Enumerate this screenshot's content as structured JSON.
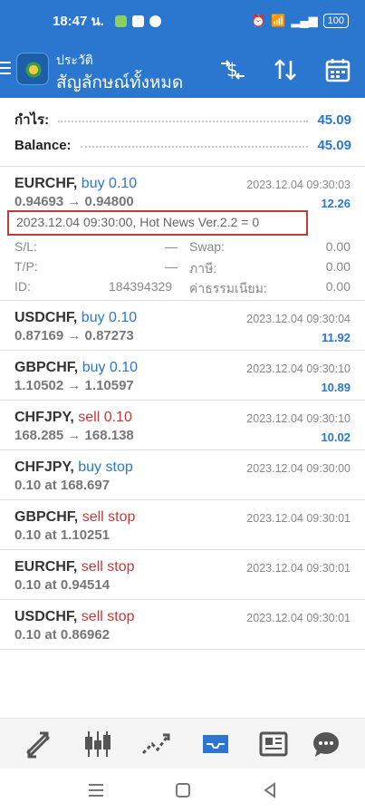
{
  "status": {
    "time": "18:47 น.",
    "battery": "100"
  },
  "appbar": {
    "subtitle": "ประวัติ",
    "title": "สัญลักษณ์ทั้งหมด"
  },
  "summary": {
    "profit_label": "กำไร:",
    "profit_value": "45.09",
    "balance_label": "Balance:",
    "balance_value": "45.09"
  },
  "trades": [
    {
      "symbol": "EURCHF,",
      "side": "buy 0.10",
      "time": "2023.12.04 09:30:03",
      "prices": "0.94693 → 0.94800",
      "profit": "12.26",
      "comment": "2023.12.04 09:30:00, Hot News Ver.2.2 = 0",
      "sl_label": "S/L:",
      "sl_value": "—",
      "swap_label": "Swap:",
      "swap_value": "0.00",
      "tp_label": "T/P:",
      "tp_value": "—",
      "tax_label": "ภาษี:",
      "tax_value": "0.00",
      "id_label": "ID:",
      "id_value": "184394329",
      "fee_label": "ค่าธรรมเนียม:",
      "fee_value": "0.00"
    },
    {
      "symbol": "USDCHF,",
      "side": "buy 0.10",
      "time": "2023.12.04 09:30:04",
      "prices": "0.87169 → 0.87273",
      "profit": "11.92"
    },
    {
      "symbol": "GBPCHF,",
      "side": "buy 0.10",
      "time": "2023.12.04 09:30:10",
      "prices": "1.10502 → 1.10597",
      "profit": "10.89"
    },
    {
      "symbol": "CHFJPY,",
      "side": "sell 0.10",
      "time": "2023.12.04 09:30:10",
      "prices": "168.285 → 168.138",
      "profit": "10.02"
    },
    {
      "symbol": "CHFJPY,",
      "side": "buy stop",
      "time": "2023.12.04 09:30:00",
      "prices": "0.10 at 168.697"
    },
    {
      "symbol": "GBPCHF,",
      "side": "sell stop",
      "time": "2023.12.04 09:30:01",
      "prices": "0.10 at 1.10251"
    },
    {
      "symbol": "EURCHF,",
      "side": "sell stop",
      "time": "2023.12.04 09:30:01",
      "prices": "0.10 at 0.94514"
    },
    {
      "symbol": "USDCHF,",
      "side": "sell stop",
      "time": "2023.12.04 09:30:01",
      "prices": "0.10 at 0.86962"
    }
  ],
  "colors": {
    "accent": "#2b77cf",
    "sell": "#c23a3a"
  }
}
